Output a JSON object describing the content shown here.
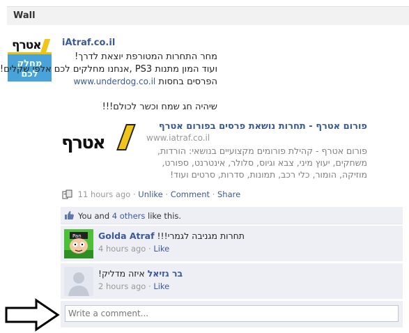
{
  "wall": {
    "title": "Wall"
  },
  "story": {
    "avatar_text_top": "אטרף",
    "avatar_text_bottom": "מחלק לכם",
    "author": "iAtraf.co.il",
    "message_line1": "מחר התחרות המטורפת יוצאת לדרך!",
    "message_line2": "ועוד המון מתנות PS3 ,אנחנו מחלקים לכם אלפי שקלים!",
    "message_line3_prefix": "הפרסים בחסות",
    "message_line3_link": "www.underdog.co.il",
    "message_line4": "שיהיה חג שמח וכשר לכולם!!!",
    "share": {
      "logo_text": "אטרף",
      "title": "פורום אטרף - תחרות נושאת פרסים בפורום אטרף",
      "url": "www.iatraf.co.il",
      "description": "פורום אטרף - קהילת פורומים מקצועיים בנושאי: הורדות, משחקים, יעוץ מיני, צבא וגיוס, סלולר, אינטרנט, ספורט, מוזיקה, הומור, כלי רכב, תמונות, סדרות, סרטים ועוד!"
    },
    "meta": {
      "time": "11 hours ago",
      "sep": "·",
      "unlike": "Unlike",
      "comment": "Comment",
      "share": "Share"
    }
  },
  "likes": {
    "you": "You and",
    "others_link": "4 others",
    "suffix": "like this."
  },
  "comments": [
    {
      "name": "Golda Atraf",
      "body": "תחרות מגניבה לגמרי!!!",
      "time": "4 hours ago",
      "like": "Like"
    },
    {
      "name": "בר גזיאל",
      "body": "איזה מדליק!",
      "time": "2 hours ago",
      "like": "Like"
    }
  ],
  "write_comment": {
    "placeholder": "Write a comment..."
  },
  "colors": {
    "link": "#3b5998",
    "feedback_bg": "#edeff4",
    "meta": "#999999"
  }
}
